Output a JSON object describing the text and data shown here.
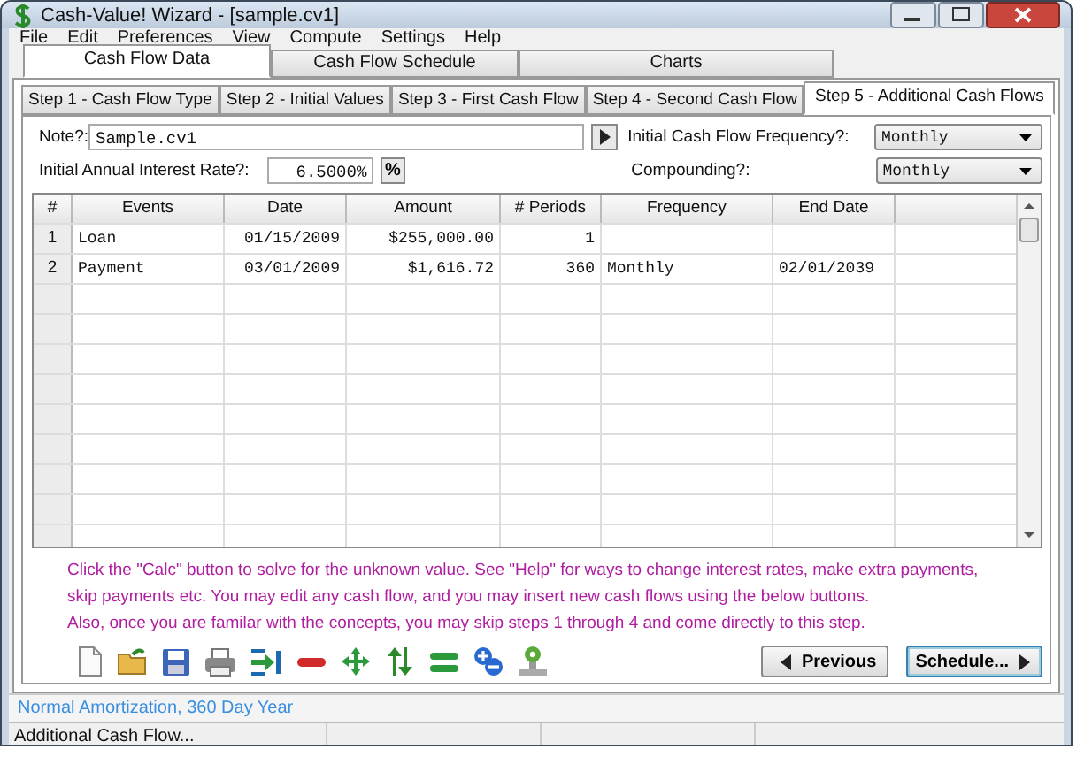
{
  "window": {
    "title": "Cash-Value! Wizard  - [sample.cv1]"
  },
  "menu": [
    "File",
    "Edit",
    "Preferences",
    "View",
    "Compute",
    "Settings",
    "Help"
  ],
  "main_tabs": [
    {
      "label": "Cash Flow Data",
      "selected": true
    },
    {
      "label": "Cash Flow Schedule",
      "selected": false
    },
    {
      "label": "Charts",
      "selected": false
    }
  ],
  "step_tabs": [
    {
      "label": "Step 1 - Cash Flow Type",
      "selected": false
    },
    {
      "label": "Step 2 - Initial Values",
      "selected": false
    },
    {
      "label": "Step 3 - First Cash Flow",
      "selected": false
    },
    {
      "label": "Step 4 - Second Cash Flow",
      "selected": false
    },
    {
      "label": "Step 5 - Additional Cash Flows",
      "selected": true
    }
  ],
  "note": {
    "label": "Note?:",
    "value": "Sample.cv1"
  },
  "rate": {
    "label": "Initial Annual Interest Rate?:",
    "value": "6.5000%",
    "button": "%"
  },
  "frequency": {
    "label": "Initial Cash Flow Frequency?:",
    "value": "Monthly"
  },
  "compounding": {
    "label": "Compounding?:",
    "value": "Monthly"
  },
  "table": {
    "columns": [
      "#",
      "Events",
      "Date",
      "Amount",
      "# Periods",
      "Frequency",
      "End Date"
    ],
    "rows": [
      [
        "1",
        "Loan",
        "01/15/2009",
        "$255,000.00",
        "1",
        "",
        ""
      ],
      [
        "2",
        "Payment",
        "03/01/2009",
        "$1,616.72",
        "360",
        "Monthly",
        "02/01/2039"
      ]
    ]
  },
  "info_text": [
    "Click the \"Calc\" button to solve for the unknown value. See \"Help\" for ways to change interest rates, make extra payments,",
    "skip payments etc. You may edit any cash flow, and you may insert new cash flows using the below buttons.",
    "Also, once you are familar with the concepts, you may skip steps 1 through 4 and come directly to this step."
  ],
  "buttons": {
    "previous": "Previous",
    "schedule": "Schedule..."
  },
  "mode_status": "Normal Amortization, 360 Day Year",
  "status_bar": "Additional Cash Flow..."
}
